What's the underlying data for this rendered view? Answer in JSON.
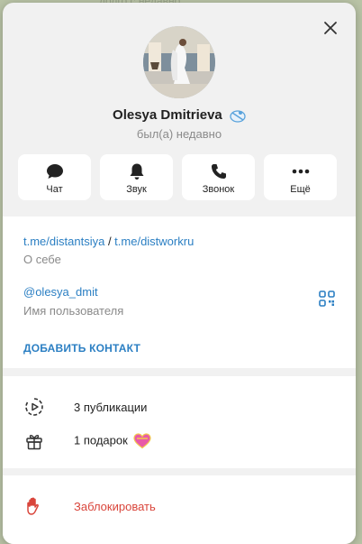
{
  "background": {
    "hint_text": "долго с недавно"
  },
  "profile": {
    "name": "Olesya Dmitrieva",
    "status": "был(а) недавно",
    "badge_icon": "emoji-status-icon",
    "avatar": "photo-avatar"
  },
  "actions": [
    {
      "label": "Чат",
      "icon": "chat-icon"
    },
    {
      "label": "Звук",
      "icon": "bell-icon"
    },
    {
      "label": "Звонок",
      "icon": "phone-icon"
    },
    {
      "label": "Ещё",
      "icon": "more-icon"
    }
  ],
  "info": {
    "link1": "t.me/distantsiya",
    "separator": " / ",
    "link2": "t.me/distworkru",
    "bio_label": "О себе",
    "username": "@olesya_dmit",
    "username_label": "Имя пользователя",
    "add_contact": "ДОБАВИТЬ КОНТАКТ"
  },
  "stats": {
    "posts": "3 публикации",
    "gifts": "1 подарок"
  },
  "block": {
    "label": "Заблокировать"
  },
  "colors": {
    "accent": "#2b7fc3",
    "danger": "#d9453b",
    "panel_bg": "#f1f1f1"
  }
}
